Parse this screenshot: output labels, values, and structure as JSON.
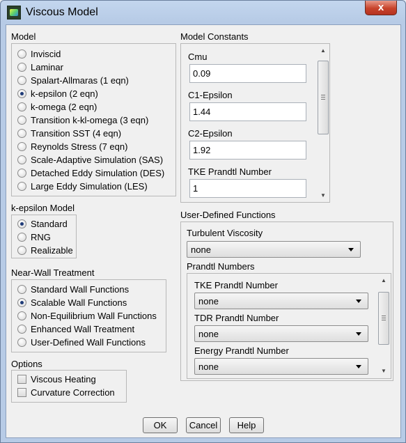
{
  "window": {
    "title": "Viscous Model",
    "close_glyph": "x"
  },
  "model": {
    "title": "Model",
    "options": [
      {
        "label": "Inviscid",
        "checked": false
      },
      {
        "label": "Laminar",
        "checked": false
      },
      {
        "label": "Spalart-Allmaras (1 eqn)",
        "checked": false
      },
      {
        "label": "k-epsilon (2 eqn)",
        "checked": true
      },
      {
        "label": "k-omega (2 eqn)",
        "checked": false
      },
      {
        "label": "Transition k-kl-omega (3 eqn)",
        "checked": false
      },
      {
        "label": "Transition SST (4 eqn)",
        "checked": false
      },
      {
        "label": "Reynolds Stress (7 eqn)",
        "checked": false
      },
      {
        "label": "Scale-Adaptive Simulation (SAS)",
        "checked": false
      },
      {
        "label": "Detached Eddy Simulation (DES)",
        "checked": false
      },
      {
        "label": "Large Eddy Simulation (LES)",
        "checked": false
      }
    ]
  },
  "keps_model": {
    "title": "k-epsilon Model",
    "options": [
      {
        "label": "Standard",
        "checked": true
      },
      {
        "label": "RNG",
        "checked": false
      },
      {
        "label": "Realizable",
        "checked": false
      }
    ]
  },
  "near_wall": {
    "title": "Near-Wall Treatment",
    "options": [
      {
        "label": "Standard Wall Functions",
        "checked": false
      },
      {
        "label": "Scalable Wall Functions",
        "checked": true
      },
      {
        "label": "Non-Equilibrium Wall Functions",
        "checked": false
      },
      {
        "label": "Enhanced Wall Treatment",
        "checked": false
      },
      {
        "label": "User-Defined Wall Functions",
        "checked": false
      }
    ]
  },
  "options": {
    "title": "Options",
    "items": [
      {
        "label": "Viscous Heating",
        "checked": false
      },
      {
        "label": "Curvature Correction",
        "checked": false
      }
    ]
  },
  "constants": {
    "title": "Model Constants",
    "fields": [
      {
        "label": "Cmu",
        "value": "0.09"
      },
      {
        "label": "C1-Epsilon",
        "value": "1.44"
      },
      {
        "label": "C2-Epsilon",
        "value": "1.92"
      },
      {
        "label": "TKE Prandtl Number",
        "value": "1"
      }
    ]
  },
  "udf": {
    "title": "User-Defined Functions",
    "turb_visc_label": "Turbulent Viscosity",
    "turb_visc_value": "none",
    "prandtl_title": "Prandtl Numbers",
    "prandtl": [
      {
        "label": "TKE Prandtl Number",
        "value": "none"
      },
      {
        "label": "TDR Prandtl Number",
        "value": "none"
      },
      {
        "label": "Energy Prandtl Number",
        "value": "none"
      }
    ]
  },
  "buttons": {
    "ok": "OK",
    "cancel": "Cancel",
    "help": "Help"
  }
}
